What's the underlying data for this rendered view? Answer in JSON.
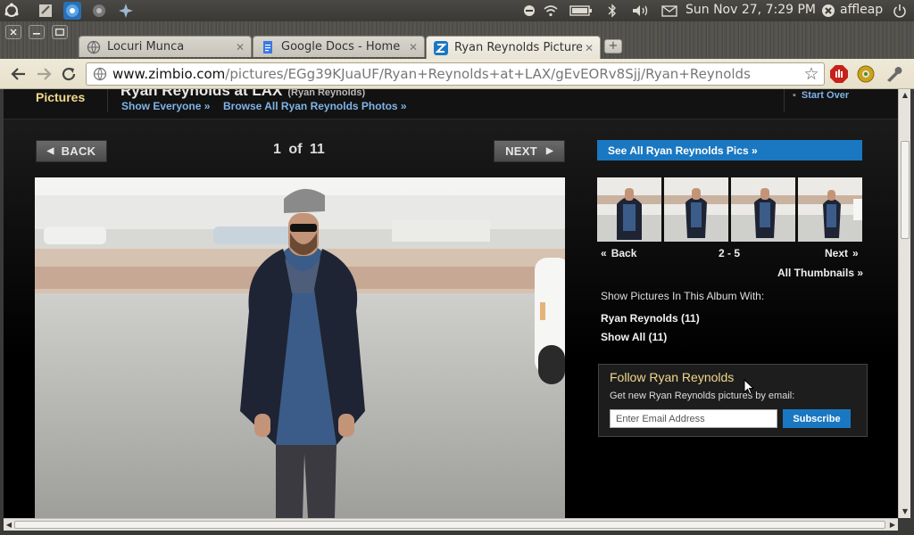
{
  "top_panel": {
    "clock": "Sun Nov 27,  7:29 PM",
    "user": "affleap",
    "launchers": [
      "ubuntu-logo-icon",
      "text-editor-icon",
      "chromium-icon",
      "system-settings-icon",
      "update-manager-icon"
    ],
    "indicators": [
      "minus-circle-icon",
      "wifi-icon",
      "battery-icon",
      "bluetooth-icon",
      "volume-icon",
      "mail-icon",
      "user-status-icon",
      "power-icon"
    ]
  },
  "window": {
    "controls": [
      "close",
      "minimize",
      "maximize"
    ],
    "tabs": [
      {
        "title": "Locuri Munca",
        "active": false
      },
      {
        "title": "Google Docs - Home",
        "active": false
      },
      {
        "title": "Ryan Reynolds Pictures",
        "active": true
      }
    ],
    "new_tab": "+"
  },
  "toolbar": {
    "url_host": "www.zimbio.com",
    "url_path": "/pictures/EGg39KJuaUF/Ryan+Reynolds+at+LAX/gEvEORv8Sjj/Ryan+Reynolds"
  },
  "page": {
    "section": "Pictures",
    "title": "Ryan Reynolds at LAX",
    "title_note": "(Ryan Reynolds)",
    "links": {
      "show_everyone": "Show Everyone »",
      "browse_all": "Browse All Ryan Reynolds Photos »",
      "start_over": "Start Over"
    },
    "gallery": {
      "back_label": "BACK",
      "next_label": "NEXT",
      "counter": "1  of  11"
    },
    "sidebar": {
      "see_all": "See All Ryan Reynolds Pics »",
      "thumb_back": "Back",
      "thumb_range": "2 - 5",
      "thumb_next": "Next",
      "all_thumbnails": "All Thumbnails »",
      "show_pictures_label": "Show Pictures In This Album With:",
      "filters": [
        "Ryan Reynolds (11)",
        "Show All (11)"
      ],
      "follow": {
        "title": "Follow Ryan Reynolds",
        "subtitle": "Get new Ryan Reynolds pictures by email:",
        "email_placeholder": "Enter Email Address",
        "subscribe": "Subscribe"
      }
    }
  },
  "colors": {
    "accent_blue": "#1a78c2",
    "gold": "#f1d98b",
    "link_blue": "#7fb3e6"
  }
}
